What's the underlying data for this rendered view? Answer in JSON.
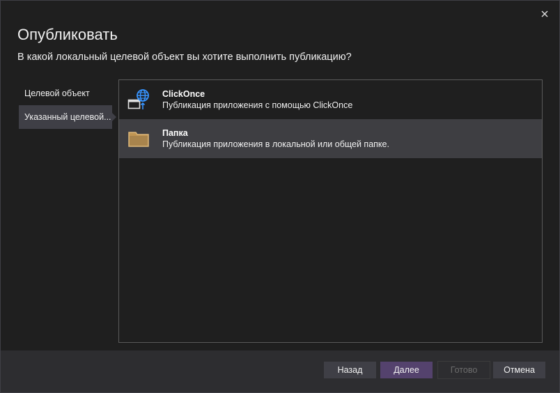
{
  "dialog": {
    "title": "Опубликовать",
    "subtitle": "В какой локальный целевой объект вы хотите выполнить публикацию?",
    "close_icon": "close-icon"
  },
  "nav": {
    "items": [
      {
        "label": "Целевой объект",
        "selected": false
      },
      {
        "label": "Указанный целевой...",
        "selected": true
      }
    ]
  },
  "targets": {
    "items": [
      {
        "title": "ClickOnce",
        "description": "Публикация приложения с помощью ClickOnce",
        "icon": "globe-window-icon",
        "selected": false
      },
      {
        "title": "Папка",
        "description": "Публикация приложения в локальной или общей папке.",
        "icon": "folder-icon",
        "selected": true
      }
    ]
  },
  "footer": {
    "back_label": "Назад",
    "next_label": "Далее",
    "finish_label": "Готово",
    "cancel_label": "Отмена"
  },
  "colors": {
    "background": "#1f1f1f",
    "selected": "#3e3e42",
    "accent": "#54426d",
    "folder": "#dcb67a",
    "globe": "#3794ff"
  }
}
